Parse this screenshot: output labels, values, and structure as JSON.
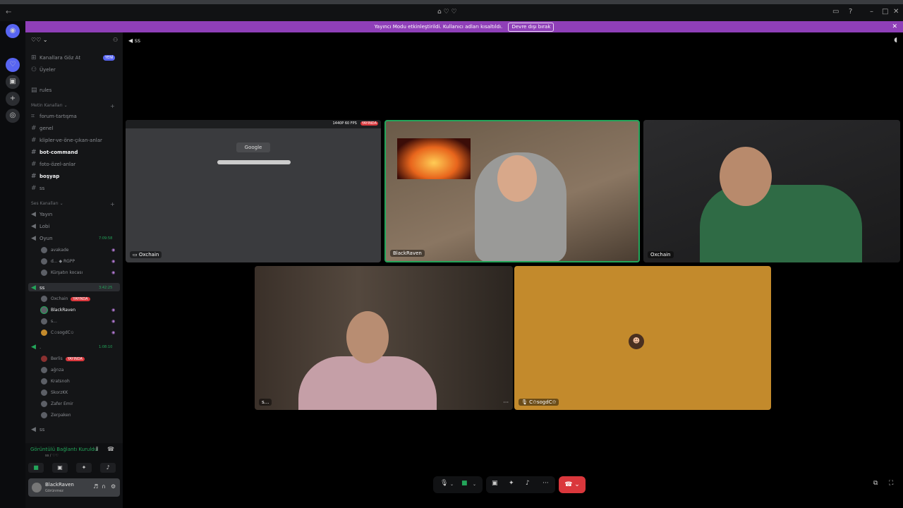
{
  "titlebar": {
    "center_icon": "⌂ ♡ ♡",
    "back_icon": "←"
  },
  "banner": {
    "text": "Yayıncı Modu etkinleştirildi. Kullanıcı adları kısaltıldı.",
    "button": "Devre dışı bırak",
    "close": "✕"
  },
  "sidebar": {
    "server_name": "♡♡",
    "browse_channels": "Kanallara Göz At",
    "browse_badge": "YENİ",
    "members": "Üyeler",
    "rules": "rules",
    "text_category": "Metin Kanalları",
    "text_channels": [
      "forum-tartışma",
      "genel",
      "klipler-ve-öne-çıkan-anlar",
      "bot-command",
      "foto-özel-anlar",
      "boşyap",
      "ss"
    ],
    "voice_category": "Ses Kanalları",
    "voice_channels": [
      "Yayın",
      "Lobi",
      "Oyun"
    ],
    "oyun_time": "7:09:58",
    "oyun_users": [
      "avakade",
      "d... ◆ RGPP",
      "Kürşatın kocası"
    ],
    "ss_channel": "ss",
    "ss_time": "3:42:25",
    "ss_users": [
      "Oxchain",
      "BlackRaven",
      "s...",
      "C✩sogdC✩"
    ],
    "live_label": "YAYINDA",
    "other_time": "1:08:10",
    "other_channel": ".",
    "other_users": [
      "Berlis",
      "ağrıza",
      "Kratsnoh",
      "SkorzKK",
      "Zafer Emir",
      "Zerpaken"
    ],
    "last_channel": "ss"
  },
  "voice_panel": {
    "status": "Görüntülü Bağlantı Kuruldu",
    "sub": "ss / ♡♡"
  },
  "user_panel": {
    "name": "BlackRaven",
    "status": "Görünmez"
  },
  "stage": {
    "channel": "ss",
    "tiles": {
      "screen": {
        "label": "Oxchain",
        "quality": "1440P 60 FPS",
        "live": "YAYINDA",
        "logo": "Google"
      },
      "cam1": {
        "label": "BlackRaven"
      },
      "cam2": {
        "label": "Oxchain"
      },
      "cam3": {
        "label": "s..."
      },
      "avatar": {
        "label": "C✩sogdC✩"
      }
    }
  },
  "colors": {
    "accent_banner": "#8f3fb8",
    "speaking": "#23a55a",
    "live": "#da373c",
    "avatar_bg": "#c38a2c"
  }
}
